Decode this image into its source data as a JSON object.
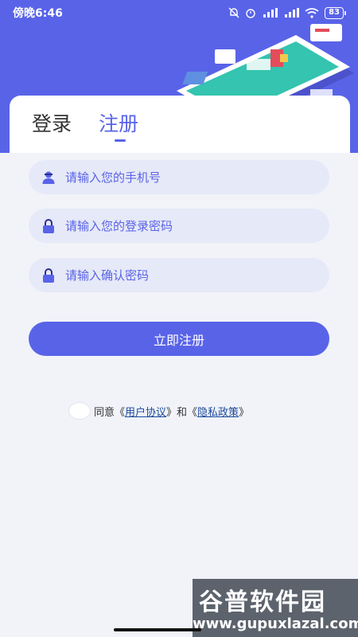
{
  "status": {
    "time": "傍晚6:46",
    "battery": "83"
  },
  "tabs": {
    "login": "登录",
    "register": "注册"
  },
  "fields": {
    "phone_placeholder": "请输入您的手机号",
    "password_placeholder": "请输入您的登录密码",
    "confirm_placeholder": "请输入确认密码"
  },
  "submit_label": "立即注册",
  "agreement": {
    "prefix": "同意《",
    "user_agreement": "用户协议",
    "middle": "》和《",
    "privacy_policy": "隐私政策",
    "suffix": "》"
  },
  "watermark": {
    "title": "谷普软件园",
    "url": "www.gupuxlazal.com"
  },
  "colors": {
    "primary": "#5963e8",
    "field_bg": "#e6e9f7",
    "page_bg": "#f1f3f9",
    "link": "#1a4a9c"
  },
  "icons": [
    "user-icon",
    "lock-icon",
    "lock-icon"
  ]
}
